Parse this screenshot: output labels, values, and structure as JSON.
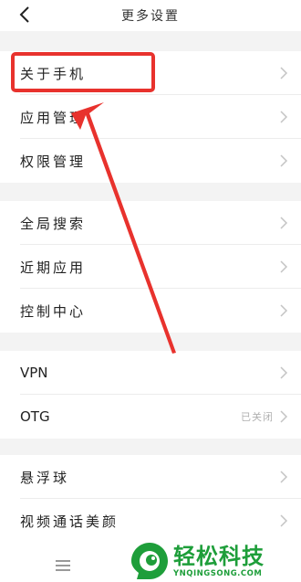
{
  "header": {
    "title": "更多设置",
    "back_icon": "back-chevron-icon"
  },
  "sections": [
    {
      "items": [
        {
          "label": "关于手机"
        },
        {
          "label": "应用管理"
        },
        {
          "label": "权限管理"
        }
      ]
    },
    {
      "items": [
        {
          "label": "全局搜索"
        },
        {
          "label": "近期应用"
        },
        {
          "label": "控制中心"
        }
      ]
    },
    {
      "items": [
        {
          "label": "VPN"
        },
        {
          "label": "OTG",
          "value": "已关闭"
        }
      ]
    },
    {
      "items": [
        {
          "label": "悬浮球"
        },
        {
          "label": "视频通话美颜"
        }
      ]
    }
  ],
  "annotation": {
    "color": "#e8322d"
  },
  "bottom_bar": {
    "icon": "menu-icon"
  },
  "watermark": {
    "text": "轻松科技",
    "subtext": "YNQINGSONG.COM",
    "color": "#1e9e3a"
  }
}
